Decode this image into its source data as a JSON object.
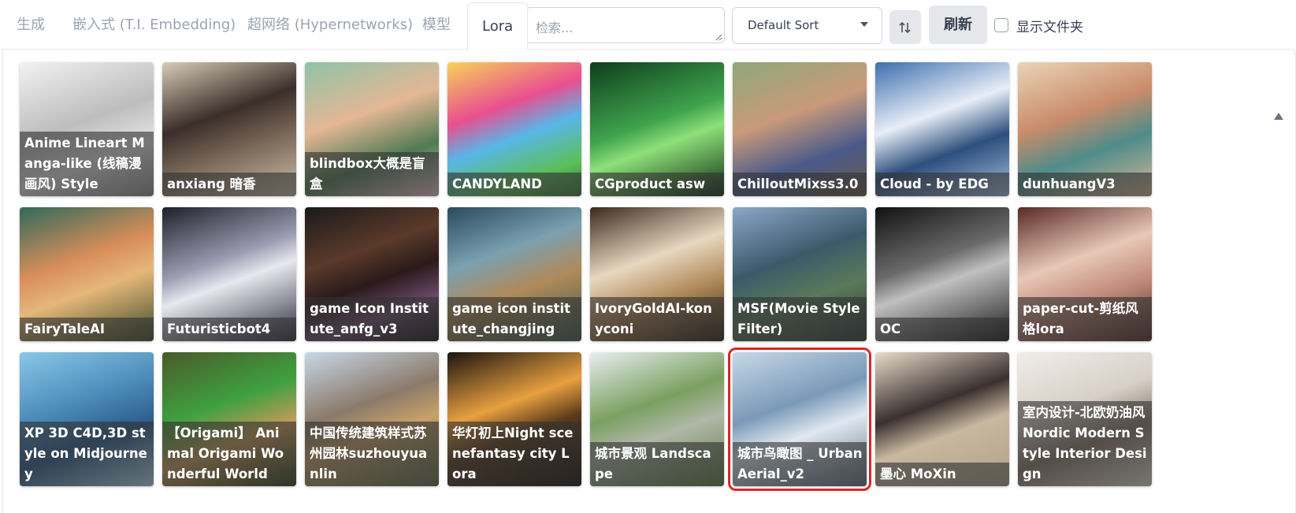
{
  "tabs": [
    {
      "label": "生成"
    },
    {
      "label": "嵌入式 (T.I. Embedding)"
    },
    {
      "label": "超网络 (Hypernetworks)"
    },
    {
      "label": "模型"
    },
    {
      "label": "Lora"
    }
  ],
  "active_tab": "Lora",
  "search": {
    "placeholder": "检索...",
    "value": ""
  },
  "sort": {
    "selected": "Default Sort"
  },
  "refresh_label": "刷新",
  "show_folders_label": "显示文件夹",
  "colors": {
    "selection": "#dc2626",
    "caption_bg": "rgba(50,50,50,0.62)"
  },
  "cards": [
    {
      "title": "Anime Lineart Manga-like (线稿漫画风) Style",
      "bg": "linear-gradient(160deg,#f2f2f2,#bdbdbd 45%,#e6e6e6 70%,#8f8f8f)"
    },
    {
      "title": "anxiang 暗香",
      "bg": "linear-gradient(160deg,#d8cdb7,#3b2e2a 40%,#7c6a5a 65%,#cbbfa8)"
    },
    {
      "title": "blindbox大概是盲盒",
      "bg": "linear-gradient(160deg,#8fc3a8,#e4b795 40%,#4f7a52 70%,#f0c9d6)"
    },
    {
      "title": "CANDYLAND",
      "bg": "linear-gradient(160deg,#f7d35a,#e94f8f 35%,#58b6e8 55%,#5cbf5a 80%,#3d7a3a)"
    },
    {
      "title": "CGproduct asw",
      "bg": "linear-gradient(160deg,#0f3d1c,#3fa34d 45%,#8fe07a 60%,#0d2c14)"
    },
    {
      "title": "ChilloutMixss3.0",
      "bg": "linear-gradient(160deg,#8fa87a,#c99a7a 40%,#4a5a8a 70%,#6c5a48)"
    },
    {
      "title": "Cloud - by EDG",
      "bg": "linear-gradient(160deg,#3d6fb0,#e8eef7 40%,#2c4f7c 65%,#a7c0de)"
    },
    {
      "title": "dunhuangV3",
      "bg": "linear-gradient(160deg,#ead4b8,#c98c6a 40%,#4f8c8a 65%,#d8b896)"
    },
    {
      "title": "FairyTaleAI",
      "bg": "linear-gradient(160deg,#2f6a5a,#d98e5a 40%,#e5b77a 60%,#3b4a2a)"
    },
    {
      "title": "Futuristicbot4",
      "bg": "linear-gradient(160deg,#1f1f2a,#9a9ab0 40%,#e8e8f0 55%,#2a2a3a)"
    },
    {
      "title": "game Icon Institute_anfg_v3",
      "bg": "linear-gradient(160deg,#1a1a1a,#5a3a2a 35%,#2a1a1a 55%,#6a4a6a 75%,#111)"
    },
    {
      "title": "game icon institute_changjing",
      "bg": "linear-gradient(160deg,#2a4a5a,#7aa0b0 35%,#b08a5a 60%,#3a5a4a)"
    },
    {
      "title": "IvoryGoldAI-konyconi",
      "bg": "linear-gradient(160deg,#3a2a1e,#e8d8c0 40%,#b08a5a 65%,#2a1e14)"
    },
    {
      "title": "MSF(Movie Style Filter)",
      "bg": "linear-gradient(160deg,#8aa8c8,#3a5a6a 40%,#5a7a5a 65%,#2a3a3a)"
    },
    {
      "title": "OC",
      "bg": "linear-gradient(160deg,#111,#6a6a6a 40%,#c0c0c0 55%,#1a1a1a)"
    },
    {
      "title": "paper-cut-剪纸风格lora",
      "bg": "linear-gradient(160deg,#5a2a24,#e8c8b8 40%,#c08a7a 65%,#4a2a24)"
    },
    {
      "title": "XP 3D C4D,3D style on Midjourney",
      "bg": "linear-gradient(160deg,#8ac8e8,#4a8ab8 40%,#2a5a8a 65%,#b8e0f0)"
    },
    {
      "title": "【Origami】 Animal Origami Wonderful World",
      "bg": "linear-gradient(160deg,#4a5a2a,#3fa040 40%,#c89a5a 65%,#2a3a1a)"
    },
    {
      "title": "中国传统建筑样式苏州园林suzhouyuanlin",
      "bg": "linear-gradient(160deg,#c8d8e8,#8a7a6a 40%,#c8a06a 60%,#5a6a4a)"
    },
    {
      "title": "华灯初上Night scenefantasy city Lora",
      "bg": "linear-gradient(160deg,#1a1410,#e8a040 40%,#5a3a1a 60%,#0f0c0a)"
    },
    {
      "title": "城市景观 Landscape",
      "bg": "linear-gradient(160deg,#e8eef0,#7aa060 40%,#b0b8a8 60%,#5a7a40)"
    },
    {
      "title": "城市鸟瞰图 _ UrbanAerial_v2",
      "bg": "linear-gradient(160deg,#c8d8e8,#7a9ab8 40%,#e0e8f0 60%,#5a7080)"
    },
    {
      "title": "墨心 MoXin",
      "bg": "linear-gradient(160deg,#e8dcc8,#3a3030 40%,#c8b8a0 60%,#b0a088)"
    },
    {
      "title": "室内设计-北欧奶油风Nordic Modern Style Interior Design",
      "bg": "linear-gradient(160deg,#f0ede8,#d8d0c8 40%,#8a7a6a 65%,#e8e4dc)"
    }
  ],
  "selected_card": "城市鸟瞰图 _ UrbanAerial_v2"
}
